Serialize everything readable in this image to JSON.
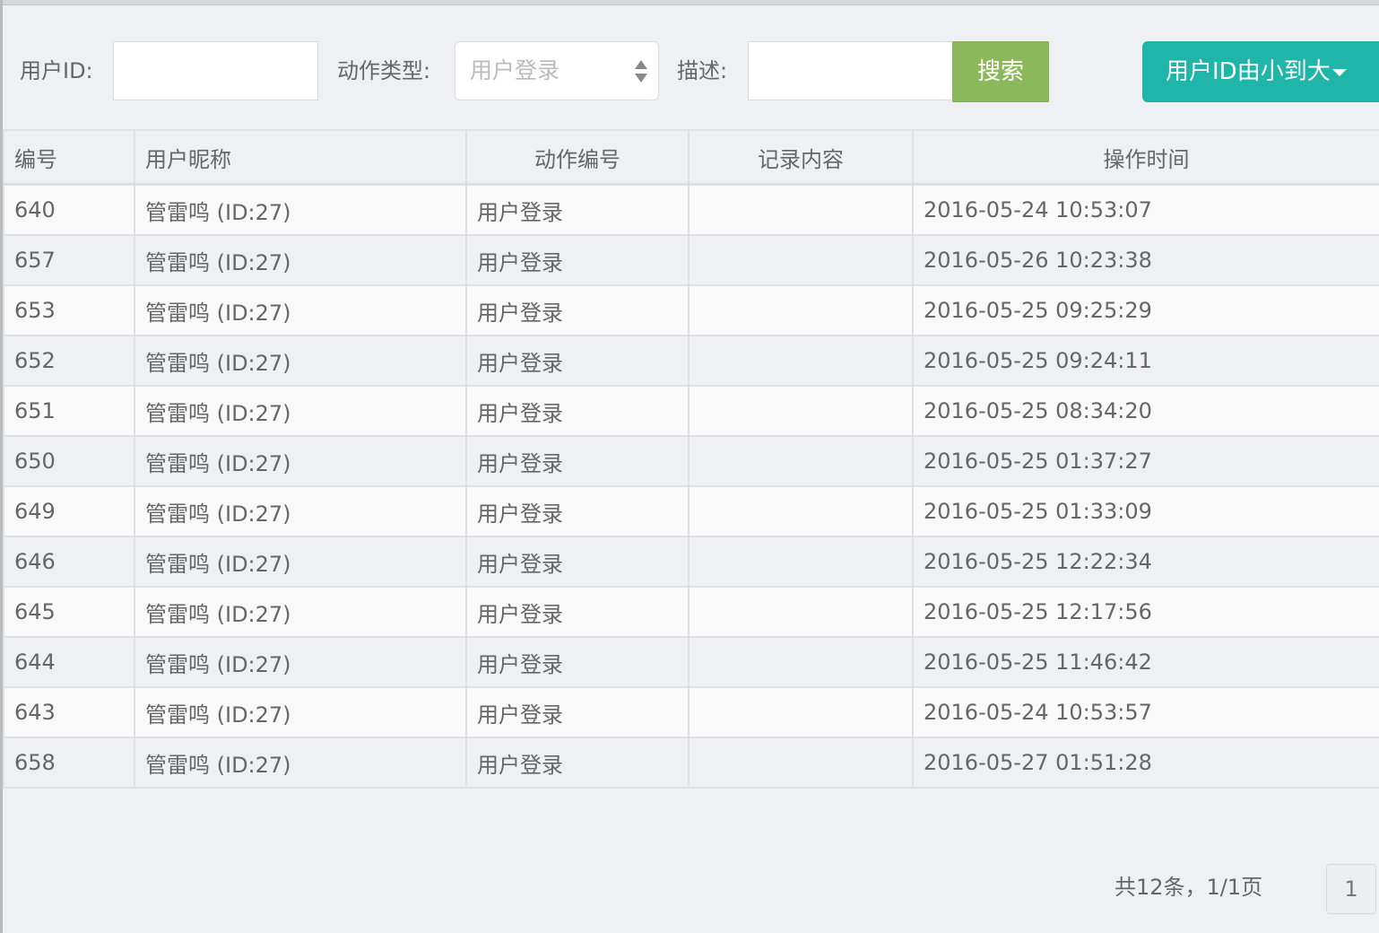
{
  "filters": {
    "user_id_label": "用户ID:",
    "user_id_value": "",
    "action_type_label": "动作类型:",
    "action_type_selected": "用户登录",
    "desc_label": "描述:",
    "desc_value": "",
    "search_button": "搜索",
    "sort_button": "用户ID由小到大"
  },
  "table": {
    "headers": {
      "id": "编号",
      "nickname": "用户昵称",
      "action": "动作编号",
      "record": "记录内容",
      "time": "操作时间"
    },
    "rows": [
      {
        "id": "640",
        "nickname": "管雷鸣 (ID:27)",
        "action": "用户登录",
        "record": "",
        "time": "2016-05-24 10:53:07"
      },
      {
        "id": "657",
        "nickname": "管雷鸣 (ID:27)",
        "action": "用户登录",
        "record": "",
        "time": "2016-05-26 10:23:38"
      },
      {
        "id": "653",
        "nickname": "管雷鸣 (ID:27)",
        "action": "用户登录",
        "record": "",
        "time": "2016-05-25 09:25:29"
      },
      {
        "id": "652",
        "nickname": "管雷鸣 (ID:27)",
        "action": "用户登录",
        "record": "",
        "time": "2016-05-25 09:24:11"
      },
      {
        "id": "651",
        "nickname": "管雷鸣 (ID:27)",
        "action": "用户登录",
        "record": "",
        "time": "2016-05-25 08:34:20"
      },
      {
        "id": "650",
        "nickname": "管雷鸣 (ID:27)",
        "action": "用户登录",
        "record": "",
        "time": "2016-05-25 01:37:27"
      },
      {
        "id": "649",
        "nickname": "管雷鸣 (ID:27)",
        "action": "用户登录",
        "record": "",
        "time": "2016-05-25 01:33:09"
      },
      {
        "id": "646",
        "nickname": "管雷鸣 (ID:27)",
        "action": "用户登录",
        "record": "",
        "time": "2016-05-25 12:22:34"
      },
      {
        "id": "645",
        "nickname": "管雷鸣 (ID:27)",
        "action": "用户登录",
        "record": "",
        "time": "2016-05-25 12:17:56"
      },
      {
        "id": "644",
        "nickname": "管雷鸣 (ID:27)",
        "action": "用户登录",
        "record": "",
        "time": "2016-05-25 11:46:42"
      },
      {
        "id": "643",
        "nickname": "管雷鸣 (ID:27)",
        "action": "用户登录",
        "record": "",
        "time": "2016-05-24 10:53:57"
      },
      {
        "id": "658",
        "nickname": "管雷鸣 (ID:27)",
        "action": "用户登录",
        "record": "",
        "time": "2016-05-27 01:51:28"
      }
    ]
  },
  "pagination": {
    "summary": "共12条，1/1页",
    "current_page": "1"
  },
  "colors": {
    "search_button": "#8cb85c",
    "sort_button": "#1fb5a9",
    "background": "#eff0f4"
  }
}
